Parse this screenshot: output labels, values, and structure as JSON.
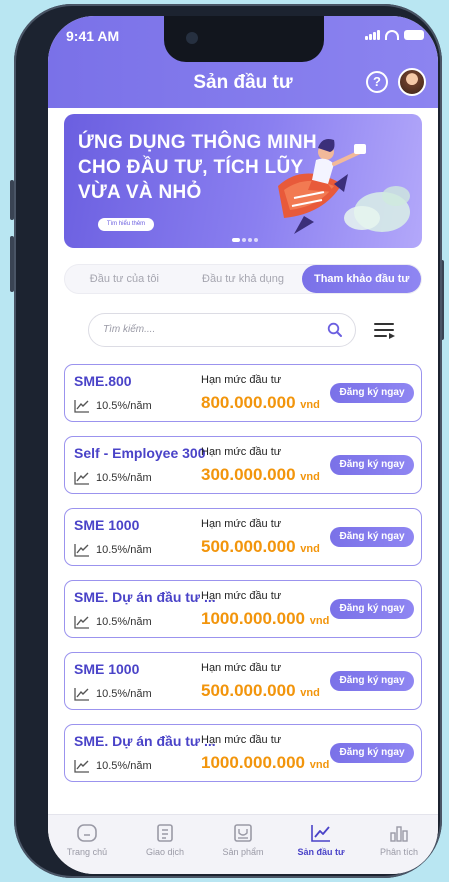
{
  "status_bar": {
    "time": "9:41 AM"
  },
  "header": {
    "title": "Sản đầu tư",
    "help_icon": "question-circle-icon"
  },
  "banner": {
    "lines": [
      "ỨNG DỤNG THÔNG MINH",
      "CHO ĐẦU TƯ, TÍCH LŨY",
      "VỪA VÀ NHỎ"
    ],
    "button_label": "Tìm hiểu thêm",
    "slide_count": 4,
    "active_slide": 1
  },
  "tabs": [
    {
      "label": "Đầu tư của tôi",
      "active": false
    },
    {
      "label": "Đầu tư khả dụng",
      "active": false
    },
    {
      "label": "Tham khảo đầu tư",
      "active": true
    }
  ],
  "search": {
    "placeholder": "Tìm kiếm...."
  },
  "products": [
    {
      "name": "SME.800",
      "rate": "10.5%/năm",
      "limit_label": "Hạn mức đầu tư",
      "limit_value": "800.000.000",
      "unit": "vnd",
      "action": "Đăng ký ngay"
    },
    {
      "name": "Self - Employee 300",
      "rate": "10.5%/năm",
      "limit_label": "Hạn mức đầu tư",
      "limit_value": "300.000.000",
      "unit": "vnd",
      "action": "Đăng ký ngay"
    },
    {
      "name": "SME 1000",
      "rate": "10.5%/năm",
      "limit_label": "Hạn mức đầu tư",
      "limit_value": "500.000.000",
      "unit": "vnd",
      "action": "Đăng ký ngay"
    },
    {
      "name": "SME. Dự án đầu tư ...",
      "rate": "10.5%/năm",
      "limit_label": "Hạn mức đầu tư",
      "limit_value": "1000.000.000",
      "unit": "vnd",
      "action": "Đăng ký ngay"
    },
    {
      "name": "SME 1000",
      "rate": "10.5%/năm",
      "limit_label": "Hạn mức đầu tư",
      "limit_value": "500.000.000",
      "unit": "vnd",
      "action": "Đăng ký ngay"
    },
    {
      "name": "SME. Dự án đầu tư ...",
      "rate": "10.5%/năm",
      "limit_label": "Hạn mức đầu tư",
      "limit_value": "1000.000.000",
      "unit": "vnd",
      "action": "Đăng ký ngay"
    }
  ],
  "bottom_nav": [
    {
      "label": "Trang chủ",
      "icon": "home-icon",
      "active": false
    },
    {
      "label": "Giao dịch",
      "icon": "receipt-icon",
      "active": false
    },
    {
      "label": "Sản phẩm",
      "icon": "product-icon",
      "active": false
    },
    {
      "label": "Sản đầu tư",
      "icon": "chart-line-icon",
      "active": true
    },
    {
      "label": "Phân tích",
      "icon": "bar-chart-icon",
      "active": false
    }
  ],
  "colors": {
    "primary": "#7a71e8",
    "accent": "#f2950c",
    "product_name": "#4a43c8",
    "background": "#b9e6f2"
  }
}
